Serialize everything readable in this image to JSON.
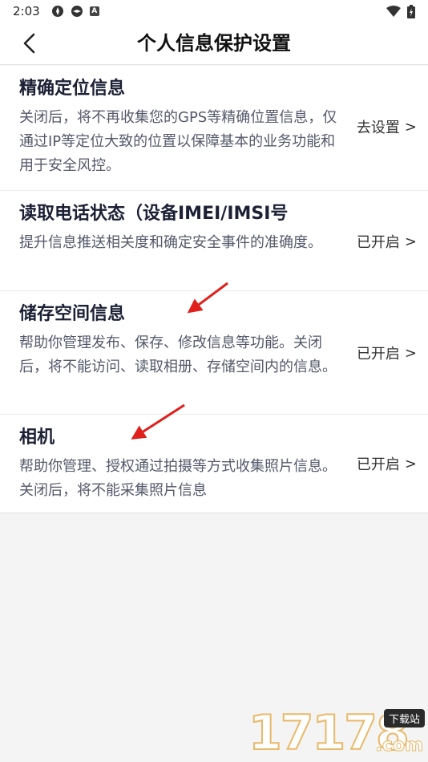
{
  "status_bar": {
    "time": "2:03",
    "icons_left": [
      "app-icon",
      "app-icon",
      "a-icon"
    ],
    "icons_right": [
      "wifi-icon",
      "battery-icon"
    ]
  },
  "header": {
    "title": "个人信息保护设置",
    "back_icon": "chevron-left-icon"
  },
  "items": [
    {
      "title": "精确定位信息",
      "desc": "关闭后，将不再收集您的GPS等精确位置信息，仅通过IP等定位大致的位置以保障基本的业务功能和用于安全风控。",
      "action": "去设置",
      "chevron": ">"
    },
    {
      "title": "读取电话状态（设备IMEI/IMSI号",
      "desc": "提升信息推送相关度和确定安全事件的准确度。",
      "action": "已开启",
      "chevron": ">"
    },
    {
      "title": "储存空间信息",
      "desc": "帮助你管理发布、保存、修改信息等功能。关闭后，将不能访问、读取相册、存储空间内的信息。",
      "action": "已开启",
      "chevron": ">"
    },
    {
      "title": "相机",
      "desc": "帮助你管理、授权通过拍摄等方式收集照片信息。关闭后，将不能采集照片信息",
      "action": "已开启",
      "chevron": ">"
    }
  ],
  "watermark": {
    "number": "17178",
    "tag": "下载站",
    "suffix": ".com"
  },
  "colors": {
    "annotation_arrow": "#e0201c",
    "page_background": "#f4f4f4",
    "card_background": "#ffffff",
    "title_text": "#1c2035",
    "desc_text": "#55596a"
  }
}
